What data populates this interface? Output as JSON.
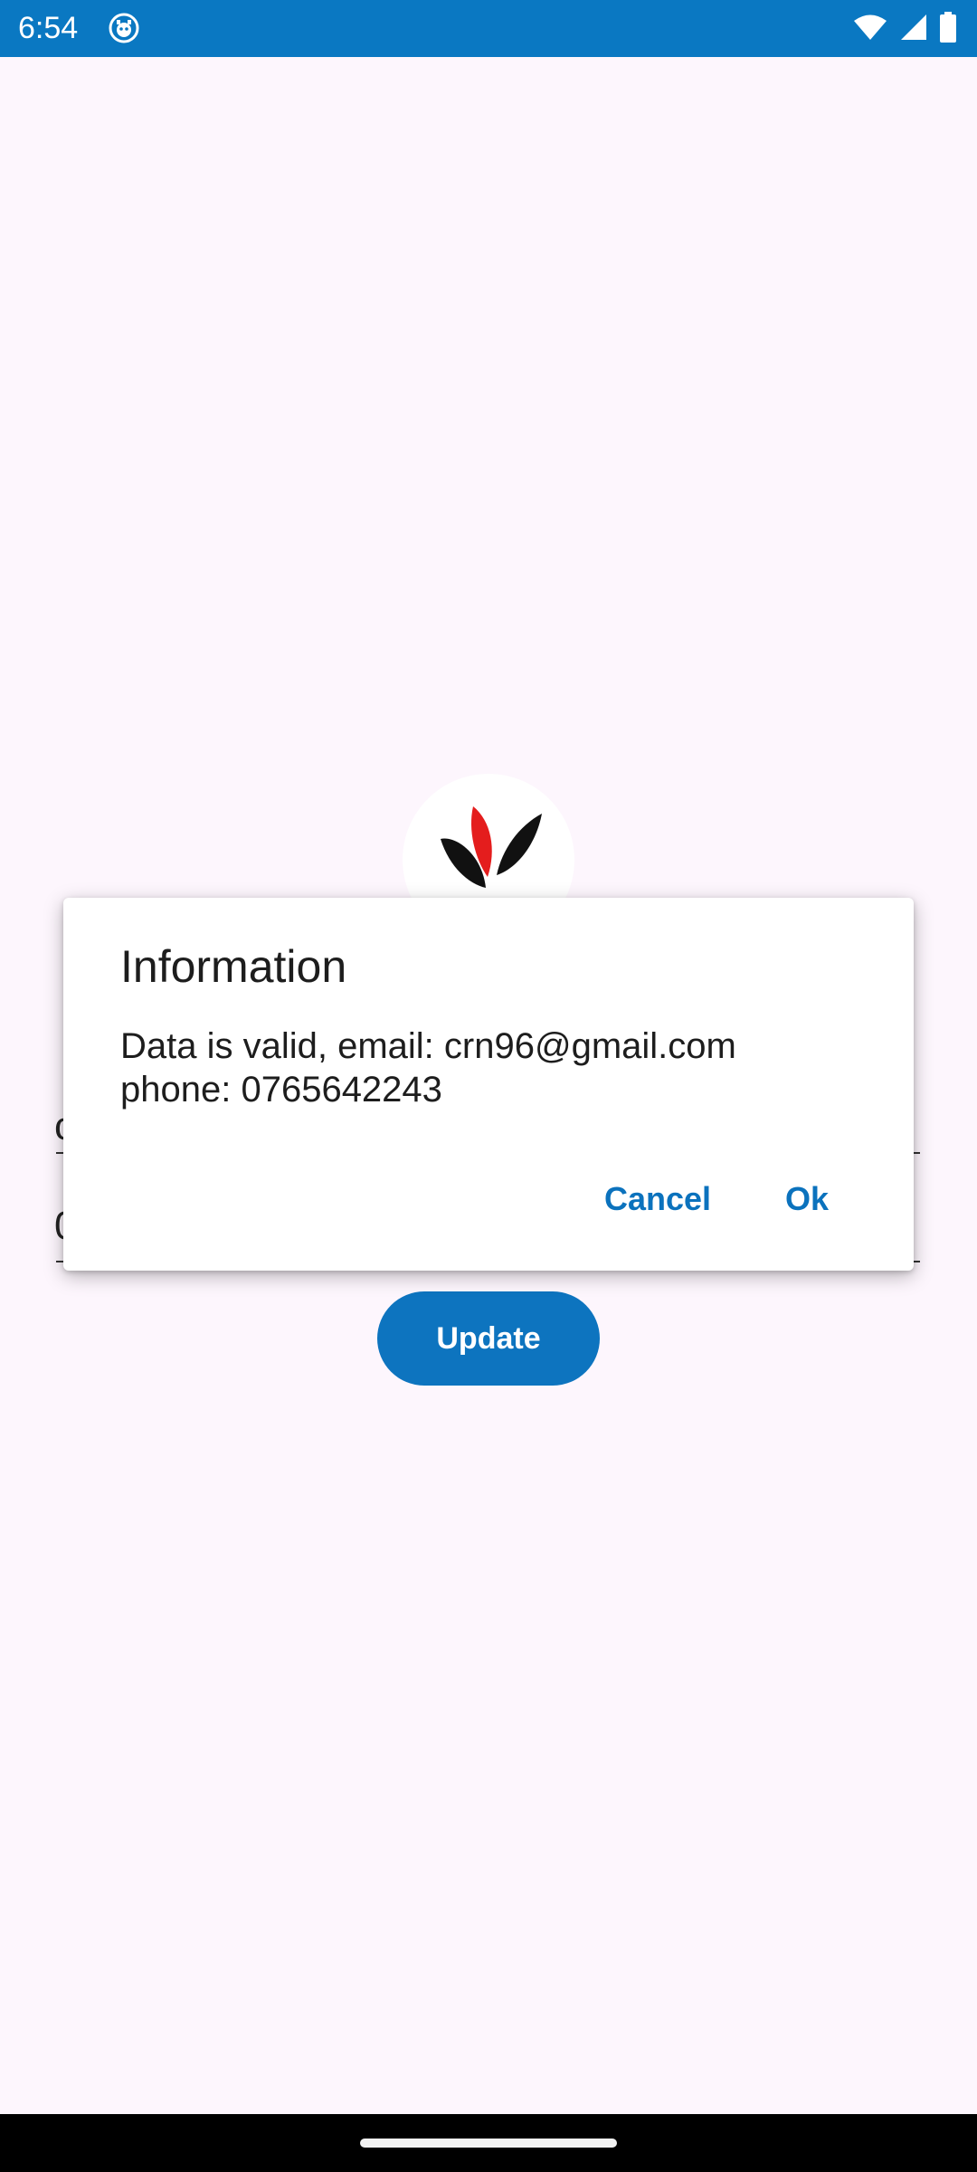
{
  "status_bar": {
    "time": "6:54",
    "background_color": "#0a78c2",
    "icons": [
      "app-notification-icon",
      "wifi-icon",
      "cell-signal-icon",
      "battery-icon"
    ]
  },
  "page": {
    "background_color": "#fdf6fd",
    "update_button": {
      "label": "Update",
      "color": "#0d74bf"
    }
  },
  "dialog": {
    "title": "Information",
    "message_line1": "Data is valid, email: crn96@gmail.com",
    "message_line2": "phone: 0765642243",
    "cancel_label": "Cancel",
    "ok_label": "Ok",
    "button_color": "#0b72bd"
  }
}
